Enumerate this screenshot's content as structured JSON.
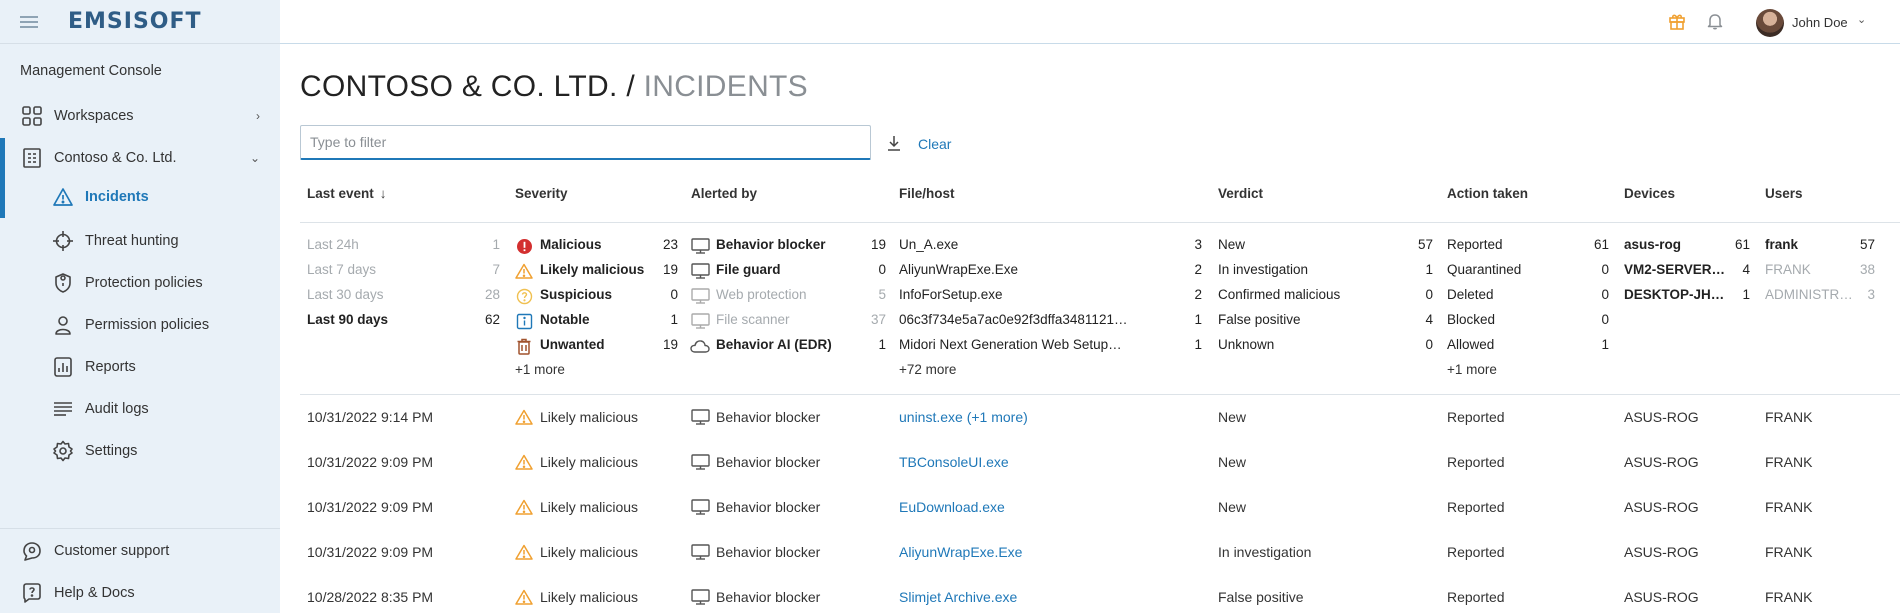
{
  "brand": {
    "logo": "EMSISOFT"
  },
  "topbar": {
    "user_name": "John Doe",
    "gift_icon": "gift-icon",
    "bell_icon": "bell-icon"
  },
  "sidebar": {
    "section_label": "Management Console",
    "items": [
      {
        "label": "Workspaces",
        "icon": "grid-icon"
      },
      {
        "label": "Contoso & Co. Ltd.",
        "icon": "building-icon"
      },
      {
        "label": "Incidents",
        "icon": "warning-icon",
        "active": true
      },
      {
        "label": "Threat hunting",
        "icon": "crosshair-icon"
      },
      {
        "label": "Protection policies",
        "icon": "shield-icon"
      },
      {
        "label": "Permission policies",
        "icon": "user-icon"
      },
      {
        "label": "Reports",
        "icon": "report-icon"
      },
      {
        "label": "Audit logs",
        "icon": "list-icon"
      },
      {
        "label": "Settings",
        "icon": "gear-icon"
      }
    ],
    "bottom": [
      {
        "label": "Customer support",
        "icon": "support-icon"
      },
      {
        "label": "Help & Docs",
        "icon": "help-icon"
      }
    ]
  },
  "page": {
    "org": "CONTOSO & CO. LTD.",
    "separator": "/",
    "title": "INCIDENTS"
  },
  "filter": {
    "placeholder": "Type to filter",
    "value": "",
    "clear_label": "Clear"
  },
  "columns": [
    "Last event",
    "Severity",
    "Alerted by",
    "File/host",
    "Verdict",
    "Action taken",
    "Devices",
    "Users"
  ],
  "facets": {
    "last_event": [
      {
        "label": "Last 24h",
        "count": "1",
        "muted": true
      },
      {
        "label": "Last 7 days",
        "count": "7",
        "muted": true
      },
      {
        "label": "Last 30 days",
        "count": "28",
        "muted": true
      },
      {
        "label": "Last 90 days",
        "count": "62",
        "bold": true
      }
    ],
    "severity": [
      {
        "label": "Malicious",
        "count": "23",
        "icon": "error-icon"
      },
      {
        "label": "Likely malicious",
        "count": "19",
        "icon": "warning-icon"
      },
      {
        "label": "Suspicious",
        "count": "0",
        "icon": "question-icon"
      },
      {
        "label": "Notable",
        "count": "1",
        "icon": "info-icon"
      },
      {
        "label": "Unwanted",
        "count": "19",
        "icon": "trash-icon"
      }
    ],
    "severity_more": "+1 more",
    "alerted_by": [
      {
        "label": "Behavior blocker",
        "count": "19",
        "icon": "monitor-icon"
      },
      {
        "label": "File guard",
        "count": "0",
        "icon": "monitor-icon"
      },
      {
        "label": "Web protection",
        "count": "5",
        "icon": "monitor-icon",
        "muted": true
      },
      {
        "label": "File scanner",
        "count": "37",
        "icon": "monitor-icon",
        "muted": true
      },
      {
        "label": "Behavior AI (EDR)",
        "count": "1",
        "icon": "cloud-icon"
      }
    ],
    "file_host": [
      {
        "label": "Un_A.exe",
        "count": "3"
      },
      {
        "label": "AliyunWrapExe.Exe",
        "count": "2"
      },
      {
        "label": "InfoForSetup.exe",
        "count": "2"
      },
      {
        "label": "06c3f734e5a7ac0e92f3dffa3481121…",
        "count": "1"
      },
      {
        "label": "Midori Next Generation Web Setup…",
        "count": "1"
      }
    ],
    "file_host_more": "+72 more",
    "verdict": [
      {
        "label": "New",
        "count": "57"
      },
      {
        "label": "In investigation",
        "count": "1"
      },
      {
        "label": "Confirmed malicious",
        "count": "0"
      },
      {
        "label": "False positive",
        "count": "4"
      },
      {
        "label": "Unknown",
        "count": "0"
      }
    ],
    "action": [
      {
        "label": "Reported",
        "count": "61"
      },
      {
        "label": "Quarantined",
        "count": "0"
      },
      {
        "label": "Deleted",
        "count": "0"
      },
      {
        "label": "Blocked",
        "count": "0"
      },
      {
        "label": "Allowed",
        "count": "1"
      }
    ],
    "action_more": "+1 more",
    "devices": [
      {
        "label": "asus-rog",
        "count": "61",
        "bold": true
      },
      {
        "label": "VM2-SERVER…",
        "count": "4",
        "bold": true
      },
      {
        "label": "DESKTOP-JH…",
        "count": "1",
        "bold": true
      }
    ],
    "users": [
      {
        "label": "frank",
        "count": "57",
        "bold": true
      },
      {
        "label": "FRANK",
        "count": "38",
        "muted": true
      },
      {
        "label": "ADMINISTR…",
        "count": "3",
        "muted": true
      }
    ]
  },
  "incidents": [
    {
      "last_event": "10/31/2022 9:14 PM",
      "severity": "Likely malicious",
      "alerted_by": "Behavior blocker",
      "file": "uninst.exe (+1 more)",
      "verdict": "New",
      "action": "Reported",
      "device": "ASUS-ROG",
      "user": "FRANK"
    },
    {
      "last_event": "10/31/2022 9:09 PM",
      "severity": "Likely malicious",
      "alerted_by": "Behavior blocker",
      "file": "TBConsoleUI.exe",
      "verdict": "New",
      "action": "Reported",
      "device": "ASUS-ROG",
      "user": "FRANK"
    },
    {
      "last_event": "10/31/2022 9:09 PM",
      "severity": "Likely malicious",
      "alerted_by": "Behavior blocker",
      "file": "EuDownload.exe",
      "verdict": "New",
      "action": "Reported",
      "device": "ASUS-ROG",
      "user": "FRANK"
    },
    {
      "last_event": "10/31/2022 9:09 PM",
      "severity": "Likely malicious",
      "alerted_by": "Behavior blocker",
      "file": "AliyunWrapExe.Exe",
      "verdict": "In investigation",
      "action": "Reported",
      "device": "ASUS-ROG",
      "user": "FRANK"
    },
    {
      "last_event": "10/28/2022 8:35 PM",
      "severity": "Likely malicious",
      "alerted_by": "Behavior blocker",
      "file": "Slimjet Archive.exe",
      "verdict": "False positive",
      "action": "Reported",
      "device": "ASUS-ROG",
      "user": "FRANK"
    }
  ],
  "colors": {
    "accent": "#1f78b8",
    "sidebar_bg": "#e9f1f8",
    "warning": "#f0a030",
    "error": "#d32f2f",
    "muted": "#a5aaae"
  }
}
